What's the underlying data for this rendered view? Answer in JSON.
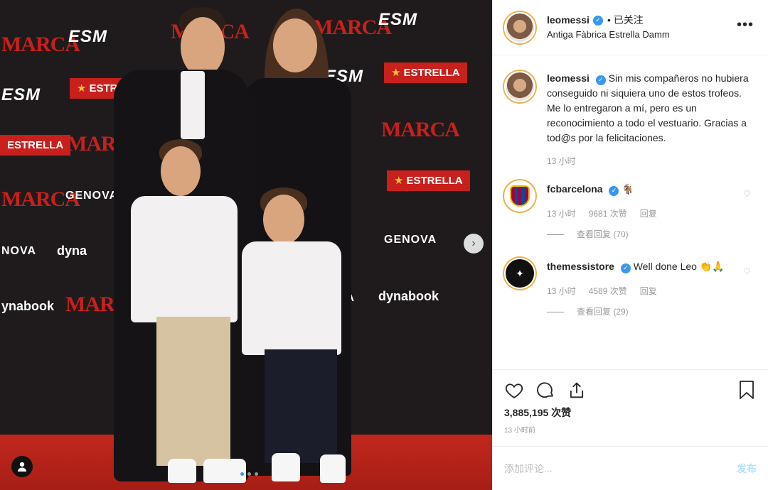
{
  "post": {
    "photo": {
      "logos": {
        "esm": "ESM",
        "marca": "MARCA",
        "estrella": "ESTRELLA",
        "genova": "GENOVA",
        "dynabook": "dynabook",
        "partial_genova": "NOVA",
        "partial_dyna": "dyna",
        "partial_dynabook": "ynabook",
        "partial_marca": "MARC",
        "partial_va": "VA"
      },
      "carousel_count": 3
    },
    "header": {
      "username": "leomessi",
      "follow_status": "• 已关注",
      "location": "Antiga Fàbrica Estrella Damm",
      "more": "•••"
    },
    "caption": {
      "username": "leomessi",
      "text": "Sin mis compañeros no hubiera conseguido ni siquiera uno de estos trofeos. Me lo entregaron a mí, pero es un reconocimiento a todo el vestuario. Gracias a tod@s por la felicitaciones.",
      "time": "13 小时"
    },
    "comments": [
      {
        "username": "fcbarcelona",
        "text": "🐐",
        "time": "13 小时",
        "likes": "9681 次赞",
        "reply": "回复",
        "view_replies": "查看回复 (70)"
      },
      {
        "username": "themessistore",
        "text": "Well done Leo 👏🙏",
        "time": "13 小时",
        "likes": "4589 次赞",
        "reply": "回复",
        "view_replies": "查看回复 (29)"
      }
    ],
    "likes_count": "3,885,195 次赞",
    "posted_ago": "13 小时前",
    "add_comment_placeholder": "添加评论...",
    "post_button": "发布"
  },
  "colors": {
    "verified": "#3897f0",
    "marca_red": "#c8201c",
    "story_ring": "#e8b34e"
  }
}
